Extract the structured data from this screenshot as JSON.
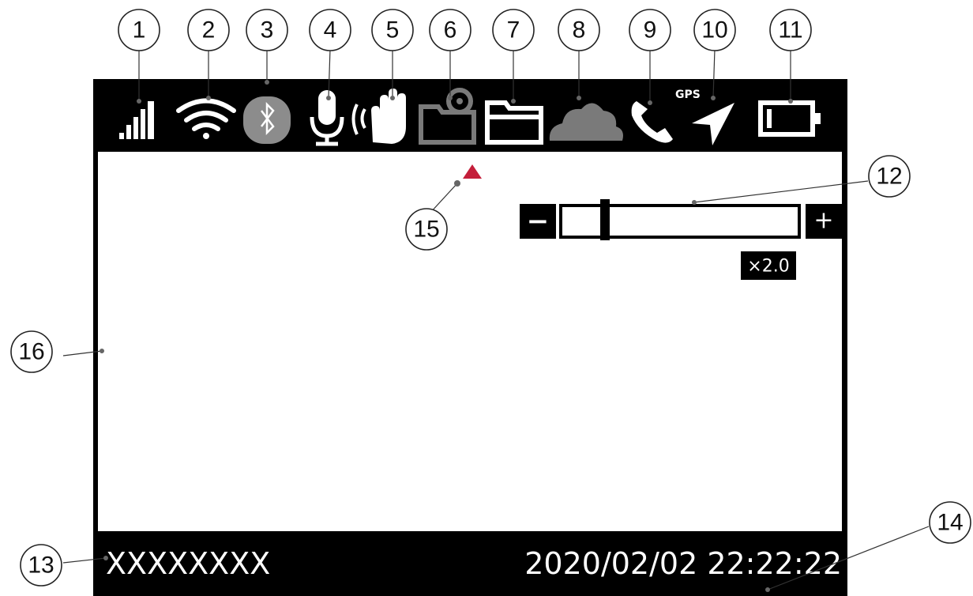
{
  "status_bar": {
    "gps_label": "GPS"
  },
  "zoom": {
    "minus_label": "−",
    "plus_label": "+",
    "value_label": "×2.0"
  },
  "bottom_bar": {
    "device_id": "XXXXXXXX",
    "datetime": "2020/02/02 22:22:22"
  },
  "callouts": {
    "c1": "1",
    "c2": "2",
    "c3": "3",
    "c4": "4",
    "c5": "5",
    "c6": "6",
    "c7": "7",
    "c8": "8",
    "c9": "9",
    "c10": "10",
    "c11": "11",
    "c12": "12",
    "c13": "13",
    "c14": "14",
    "c15": "15",
    "c16": "16"
  },
  "colors": {
    "frame": "#000000",
    "bluetooth_bg": "#8c8c8c",
    "grey_icon": "#7a7a7a",
    "compass_marker": "#c41e3a"
  }
}
